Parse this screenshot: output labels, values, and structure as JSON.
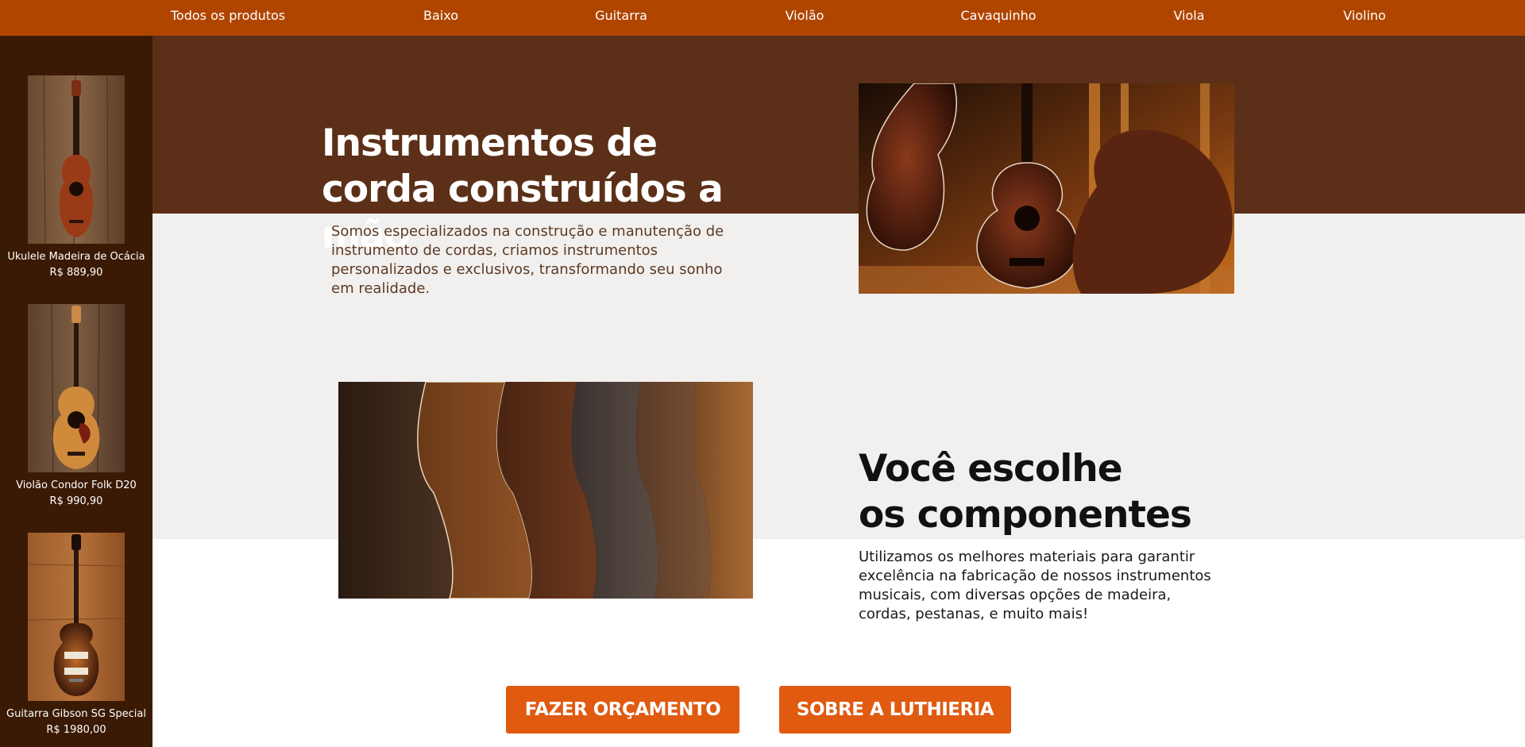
{
  "nav": {
    "items": [
      "Todos os produtos",
      "Baixo",
      "Guitarra",
      "Violão",
      "Cavaquinho",
      "Viola",
      "Violino"
    ]
  },
  "sidebar": {
    "products": [
      {
        "name": "Ukulele Madeira de Ocácia",
        "price": "R$ 889,90"
      },
      {
        "name": "Violão Condor Folk D20",
        "price": "R$ 990,90"
      },
      {
        "name": "Guitarra Gibson SG Special",
        "price": "R$ 1980,00"
      }
    ]
  },
  "hero": {
    "title": "Instrumentos de corda construídos a mão",
    "text": "Somos especializados na construção e manutenção de instrumento de cordas, criamos instrumentos personalizados e exclusivos, transformando seu sonho em realidade."
  },
  "components": {
    "title_line1": "Você escolhe",
    "title_line2": "os componentes",
    "text": "Utilizamos os melhores materiais para garantir excelência na fabricação de nossos instrumentos musicais, com diversas opções de madeira, cordas, pestanas, e muito mais!"
  },
  "buttons": {
    "quote": "FAZER ORÇAMENTO",
    "about": "SOBRE A LUTHIERIA"
  },
  "colors": {
    "nav": "#b04500",
    "sidebar": "#3b1a05",
    "hero_band": "#5c3018",
    "grey_band": "#f2f0ee",
    "button": "#e05a10"
  }
}
